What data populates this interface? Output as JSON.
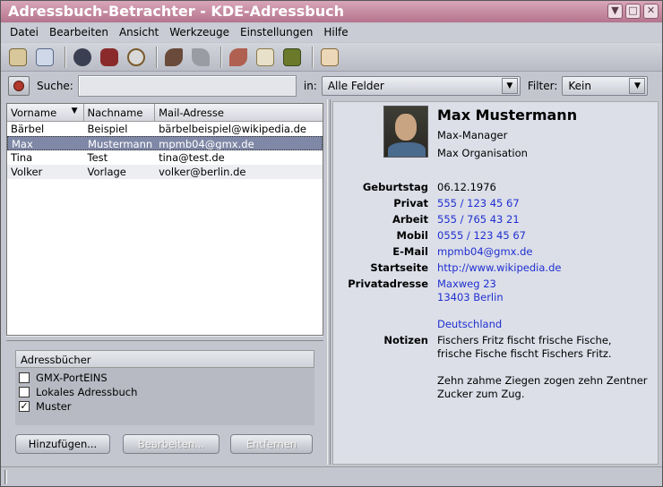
{
  "window": {
    "title": "Adressbuch-Betrachter - KDE-Adressbuch"
  },
  "menu": [
    "Datei",
    "Bearbeiten",
    "Ansicht",
    "Werkzeuge",
    "Einstellungen",
    "Hilfe"
  ],
  "toolbar_icons": [
    "open-addressbook-icon",
    "import-icon",
    "save-icon",
    "print-icon",
    "search-icon",
    "undo-icon",
    "redo-icon",
    "cut-icon",
    "copy-icon",
    "paste-icon",
    "new-contact-icon"
  ],
  "search": {
    "label": "Suche:",
    "value": "",
    "in_label": "in:",
    "in_value": "Alle Felder",
    "filter_label": "Filter:",
    "filter_value": "Kein"
  },
  "contacts": {
    "columns": [
      "Vorname",
      "Nachname",
      "Mail-Adresse"
    ],
    "rows": [
      {
        "first": "Bärbel",
        "last": "Beispiel",
        "mail": "bärbelbeispiel@wikipedia.de"
      },
      {
        "first": "Max",
        "last": "Mustermann",
        "mail": "mpmb04@gmx.de"
      },
      {
        "first": "Tina",
        "last": "Test",
        "mail": "tina@test.de"
      },
      {
        "first": "Volker",
        "last": "Vorlage",
        "mail": "volker@berlin.de"
      }
    ]
  },
  "addressbooks": {
    "header": "Adressbücher",
    "items": [
      {
        "label": "GMX-PortEINS",
        "checked": ""
      },
      {
        "label": "Lokales Adressbuch",
        "checked": ""
      },
      {
        "label": "Muster",
        "checked": "✓"
      }
    ],
    "buttons": {
      "add": "Hinzufügen...",
      "edit": "Bearbeiten...",
      "remove": "Entfernen"
    }
  },
  "detail": {
    "name": "Max Mustermann",
    "role": "Max-Manager",
    "org": "Max Organisation",
    "fields": [
      {
        "key": "Geburtstag",
        "value": "06.12.1976"
      },
      {
        "key": "Privat",
        "value": "555 / 123 45 67"
      },
      {
        "key": "Arbeit",
        "value": "555 / 765 43 21"
      },
      {
        "key": "Mobil",
        "value": "0555 / 123 45 67"
      },
      {
        "key": "E-Mail",
        "value": "mpmb04@gmx.de"
      },
      {
        "key": "Startseite",
        "value": "http://www.wikipedia.de"
      },
      {
        "key": "Privatadresse",
        "value": "Maxweg 23"
      }
    ],
    "address_city": "13403 Berlin",
    "address_country": "Deutschland",
    "notes_key": "Notizen",
    "notes": [
      "Fischers Fritz fischt frische Fische,",
      "frische Fische fischt Fischers Fritz.",
      "Zehn zahme Ziegen zogen zehn Zentner",
      "Zucker zum Zug."
    ]
  }
}
